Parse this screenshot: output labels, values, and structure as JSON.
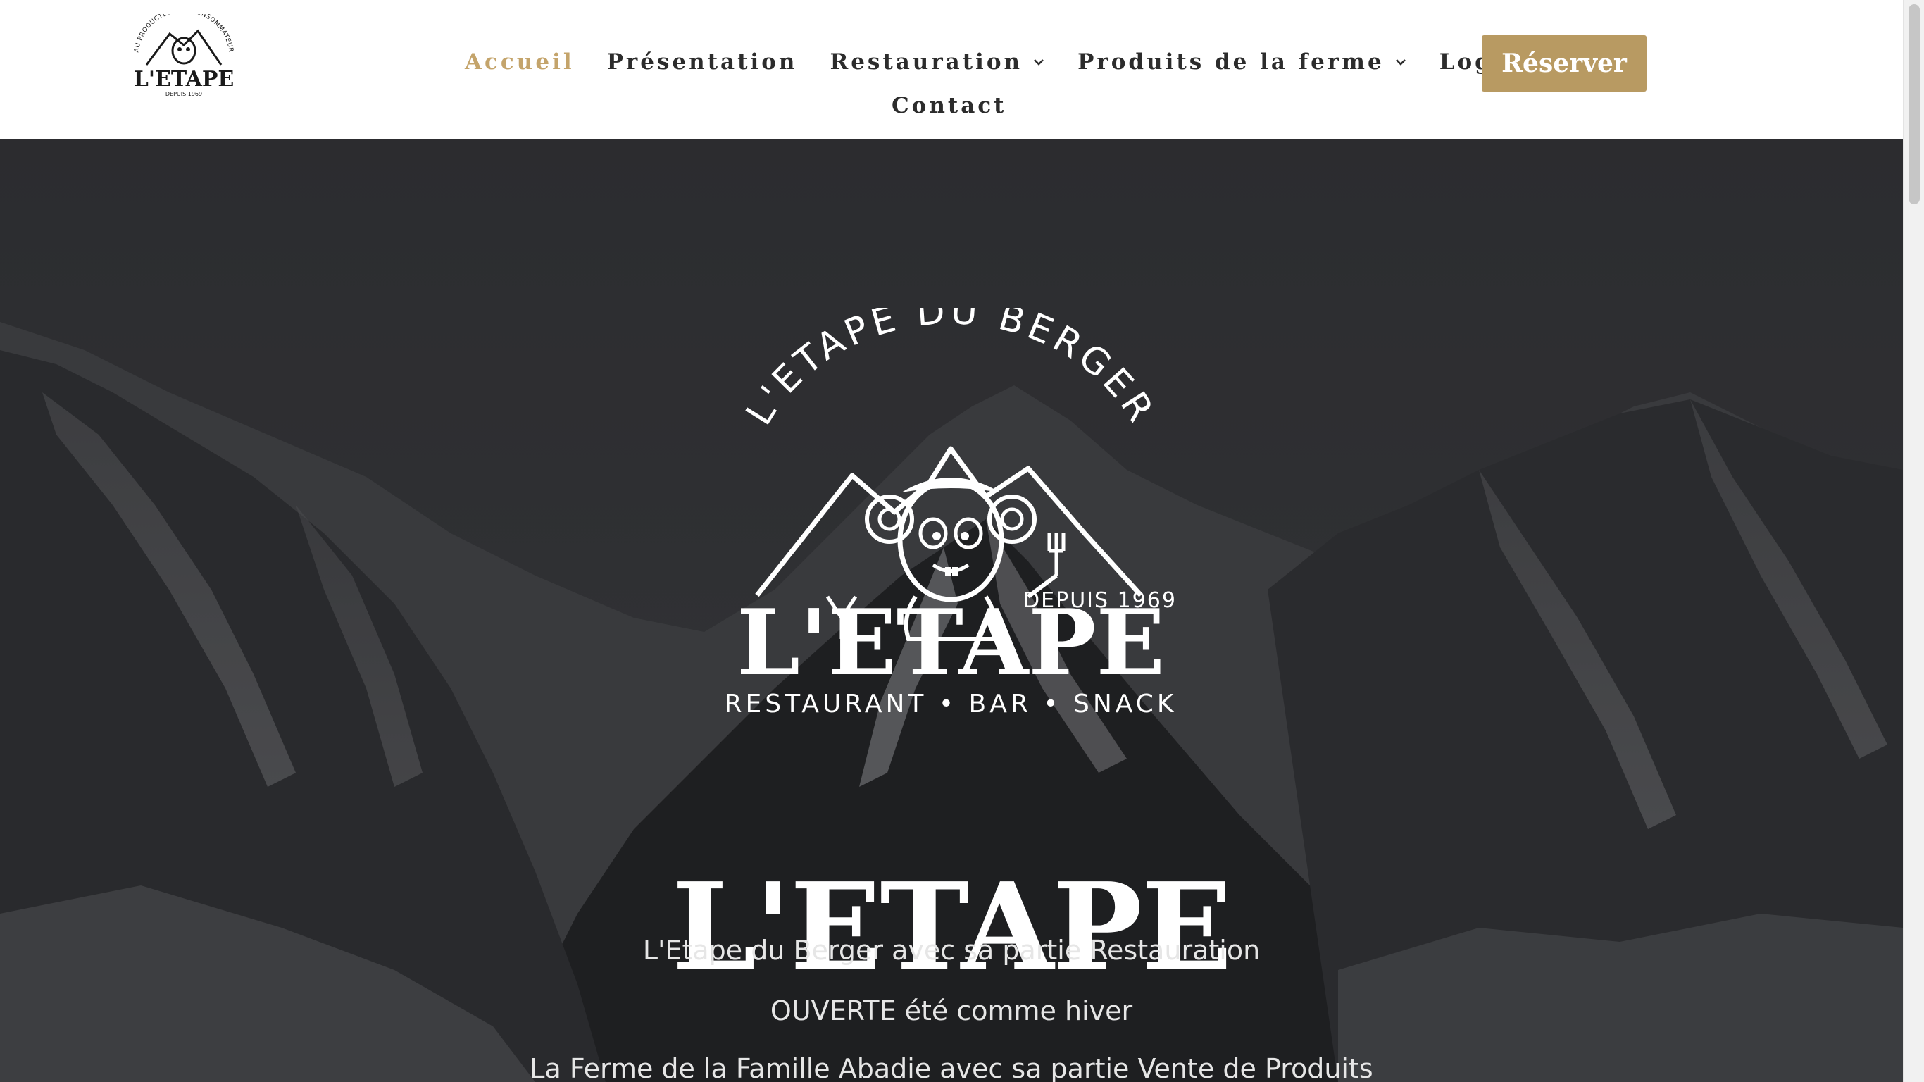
{
  "header": {
    "logo": {
      "arc_text": "AU PRODUCTEUR AU CONSOMMATEUR",
      "name": "L'ETAPE",
      "since": "DEPUIS 1969"
    },
    "nav": [
      {
        "label": "Accueil",
        "active": true
      },
      {
        "label": "Présentation"
      },
      {
        "label": "Restauration",
        "has_dropdown": true
      },
      {
        "label": "Produits de la ferme",
        "has_dropdown": true
      },
      {
        "label": "Logement"
      },
      {
        "label": "Contact"
      }
    ],
    "reserve_label": "Réserver"
  },
  "colors": {
    "accent": "#c4a46b",
    "button": "#b89a62",
    "nav_text": "#2c2c2c",
    "hero_overlay": "#3f4044"
  },
  "hero": {
    "logo": {
      "arc_text": "L'ETAPE DU BERGER",
      "since": "DEPUIS 1969",
      "name": "L'ETAPE",
      "tagline": "RESTAURANT • BAR • SNACK"
    },
    "title": "L'ETAPE",
    "lines": [
      "L'Etape du Berger avec sa partie Restauration",
      "OUVERTE été comme hiver",
      "La Ferme de la Famille Abadie avec sa partie Vente de Produits"
    ]
  }
}
